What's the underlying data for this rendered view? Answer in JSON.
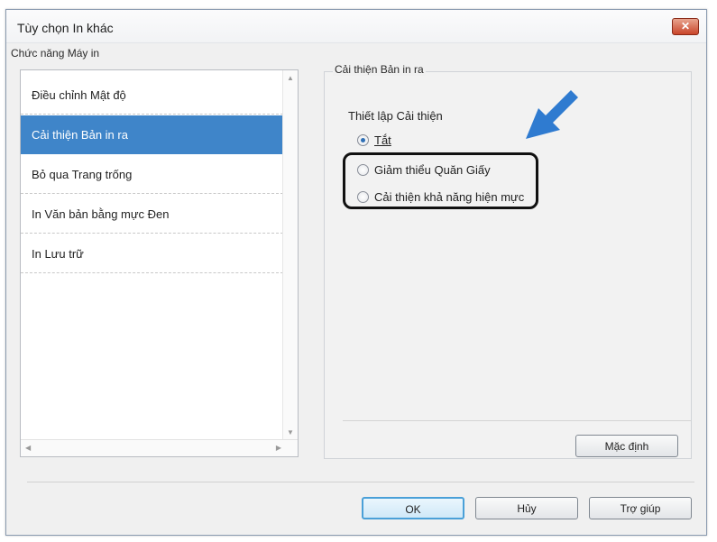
{
  "window": {
    "title": "Tùy chọn In khác",
    "close_label": "✕"
  },
  "left_group": {
    "label": "Chức năng Máy in",
    "items": [
      {
        "label": "Điều chỉnh Mật độ"
      },
      {
        "label": "Cải thiện Bản in ra",
        "selected": true
      },
      {
        "label": "Bỏ qua Trang trống"
      },
      {
        "label": "In Văn bản bằng mực Đen"
      },
      {
        "label": "In Lưu trữ"
      }
    ]
  },
  "right_panel": {
    "section_title": "Cải thiện Bản in ra",
    "settings_label": "Thiết lập Cải thiện",
    "options": [
      {
        "label": "Tắt",
        "checked": true
      },
      {
        "label": "Giảm thiểu Quăn Giấy",
        "checked": false
      },
      {
        "label": "Cải thiện khả năng hiện mực",
        "checked": false
      }
    ],
    "default_button": "Mặc định"
  },
  "footer": {
    "ok": "OK",
    "cancel": "Hủy",
    "help": "Trợ giúp"
  },
  "colors": {
    "selection": "#3f85c9",
    "arrow": "#2f7bd0",
    "close": "#c9452a"
  }
}
